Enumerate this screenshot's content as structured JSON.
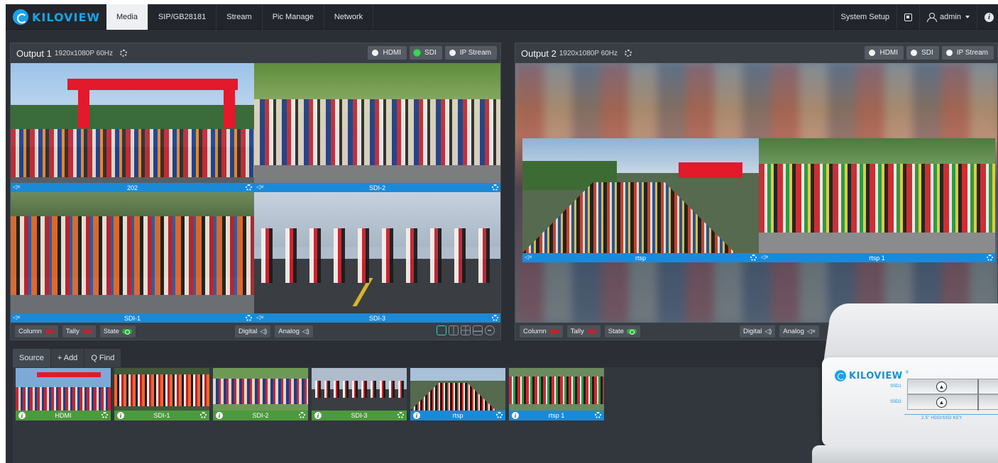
{
  "brand": {
    "name": "KILOVIEW",
    "accent": "#19a3ea"
  },
  "nav": {
    "items": [
      "Media",
      "SIP/GB28181",
      "Stream",
      "Pic Manage",
      "Network"
    ],
    "active": "Media",
    "system_setup": "System Setup",
    "user": "admin"
  },
  "outputs": [
    {
      "title": "Output 1",
      "resolution": "1920x1080P 60Hz",
      "sources": [
        {
          "label": "HDMI",
          "selected": false
        },
        {
          "label": "SDI",
          "selected": true
        },
        {
          "label": "IP Stream",
          "selected": false
        }
      ],
      "tiles": [
        {
          "label": "202"
        },
        {
          "label": "SDI-2"
        },
        {
          "label": "SDI-1"
        },
        {
          "label": "SDI-3"
        }
      ],
      "footer": {
        "column": "Column",
        "tally": "Tally",
        "state": "State",
        "digital": "Digital",
        "analog": "Analog"
      }
    },
    {
      "title": "Output 2",
      "resolution": "1920x1080P 60Hz",
      "sources": [
        {
          "label": "HDMI",
          "selected": false
        },
        {
          "label": "SDI",
          "selected": false
        },
        {
          "label": "IP Stream",
          "selected": false
        }
      ],
      "tiles": [
        {
          "label": "rtsp"
        },
        {
          "label": "rtsp 1"
        }
      ],
      "footer": {
        "column": "Column",
        "tally": "Tally",
        "state": "State",
        "digital": "Digital",
        "analog": "Analog"
      }
    }
  ],
  "source_panel": {
    "tabs": [
      "Source",
      "+ Add",
      "Q Find"
    ],
    "items": [
      {
        "label": "HDMI",
        "status_color": "#4c9a3e"
      },
      {
        "label": "SDI-1",
        "status_color": "#4c9a3e"
      },
      {
        "label": "SDI-2",
        "status_color": "#4c9a3e"
      },
      {
        "label": "SDI-3",
        "status_color": "#4c9a3e"
      },
      {
        "label": "rtsp",
        "status_color": "#1a8ad8"
      },
      {
        "label": "rtsp 1",
        "status_color": "#1a8ad8"
      }
    ]
  },
  "device": {
    "brand": "KILOVIEW",
    "bays": [
      "SSD1",
      "SSD2"
    ],
    "caption": "2.5\" HDD/SSD    KEY"
  }
}
